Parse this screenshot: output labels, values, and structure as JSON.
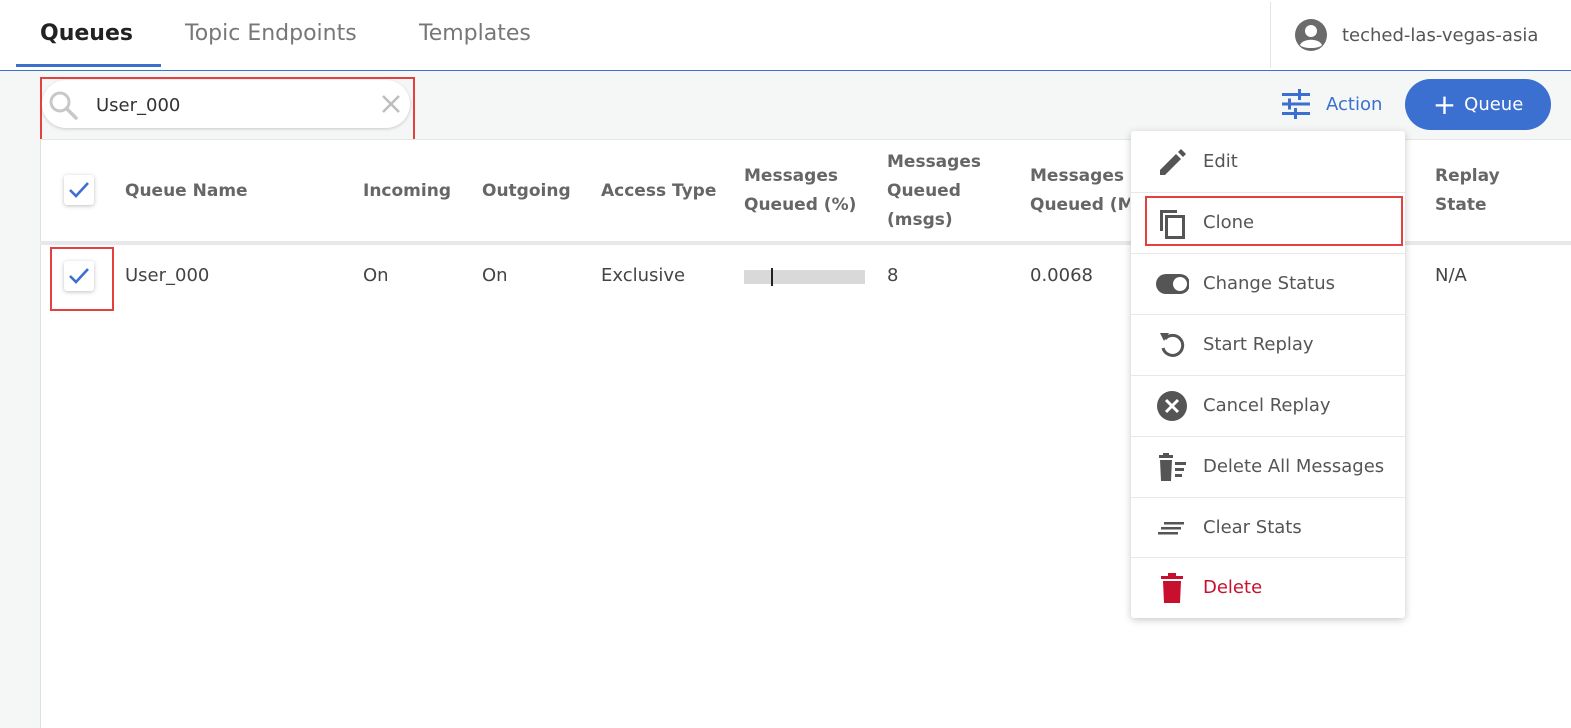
{
  "tabs": [
    {
      "label": "Queues",
      "active": true
    },
    {
      "label": "Topic Endpoints",
      "active": false
    },
    {
      "label": "Templates",
      "active": false
    }
  ],
  "user": {
    "name": "teched-las-vegas-asia"
  },
  "search": {
    "value": "User_000"
  },
  "toolbar": {
    "action_label": "Action",
    "add_queue_label": "Queue"
  },
  "table": {
    "columns": [
      {
        "lines": [
          "Queue Name"
        ]
      },
      {
        "lines": [
          "Incoming"
        ]
      },
      {
        "lines": [
          "Outgoing"
        ]
      },
      {
        "lines": [
          "Access Type"
        ]
      },
      {
        "lines": [
          "Messages",
          "Queued (%)"
        ]
      },
      {
        "lines": [
          "Messages",
          "Queued",
          "(msgs)"
        ]
      },
      {
        "lines": [
          "Messages",
          "Queued (MB)"
        ]
      },
      {
        "lines": [
          "Replay",
          "State"
        ]
      }
    ],
    "rows": [
      {
        "checked": true,
        "queue_name": "User_000",
        "incoming": "On",
        "outgoing": "On",
        "access_type": "Exclusive",
        "messages_queued_pct": 0.2,
        "messages_queued_msgs": "8",
        "messages_queued_mb": "0.0068",
        "replay_state": "N/A"
      }
    ],
    "select_all_checked": true
  },
  "action_menu": {
    "items": [
      {
        "label": "Edit",
        "icon": "pencil-icon"
      },
      {
        "label": "Clone",
        "icon": "copy-icon"
      },
      {
        "label": "Change Status",
        "icon": "toggle-icon"
      },
      {
        "label": "Start Replay",
        "icon": "replay-icon"
      },
      {
        "label": "Cancel Replay",
        "icon": "cancel-circle-icon"
      },
      {
        "label": "Delete All Messages",
        "icon": "delete-list-icon"
      },
      {
        "label": "Clear Stats",
        "icon": "clear-lines-icon"
      },
      {
        "label": "Delete",
        "icon": "trash-icon",
        "danger_color": "#c8102e"
      }
    ]
  },
  "colors": {
    "accent": "#3b6fd0",
    "highlight_outline": "#e34040",
    "danger": "#c8102e"
  }
}
